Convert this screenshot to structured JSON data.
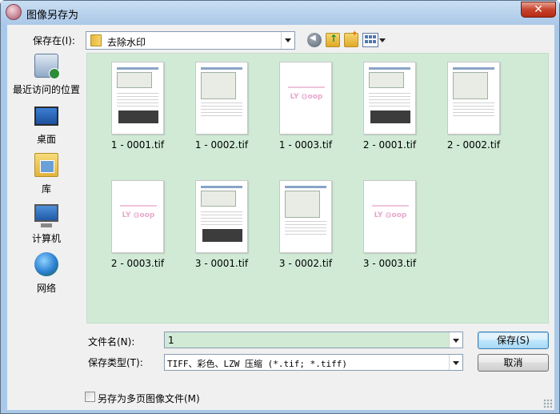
{
  "window": {
    "title": "图像另存为",
    "close_label": "✕"
  },
  "toolbar": {
    "save_in_label": "保存在(I):",
    "current_folder": "去除水印"
  },
  "places": [
    {
      "label": "最近访问的位置",
      "icon": "recent-places-icon"
    },
    {
      "label": "桌面",
      "icon": "desktop-icon"
    },
    {
      "label": "库",
      "icon": "library-icon"
    },
    {
      "label": "计算机",
      "icon": "computer-icon"
    },
    {
      "label": "网络",
      "icon": "network-icon"
    }
  ],
  "files": [
    {
      "name": "1 - 0001.tif",
      "thumb": "screenshot"
    },
    {
      "name": "1 - 0002.tif",
      "thumb": "screenshot"
    },
    {
      "name": "1 - 0003.tif",
      "thumb": "watermark"
    },
    {
      "name": "2 - 0001.tif",
      "thumb": "screenshot"
    },
    {
      "name": "2 - 0002.tif",
      "thumb": "screenshot"
    },
    {
      "name": "2 - 0003.tif",
      "thumb": "watermark"
    },
    {
      "name": "3 - 0001.tif",
      "thumb": "screenshot"
    },
    {
      "name": "3 - 0002.tif",
      "thumb": "screenshot"
    },
    {
      "name": "3 - 0003.tif",
      "thumb": "watermark"
    }
  ],
  "form": {
    "filename_label": "文件名(N):",
    "filename_value": "1",
    "filetype_label": "保存类型(T):",
    "filetype_value": "TIFF、彩色、LZW 压缩 (*.tif; *.tiff)",
    "save_button": "保存(S)",
    "cancel_button": "取消",
    "multipage_label": "另存为多页图像文件(M)",
    "multipage_checked": false
  },
  "colors": {
    "titlebar": "#aac8e8",
    "browser_bg": "#d0ead6",
    "client_bg": "#f0f0f0"
  }
}
